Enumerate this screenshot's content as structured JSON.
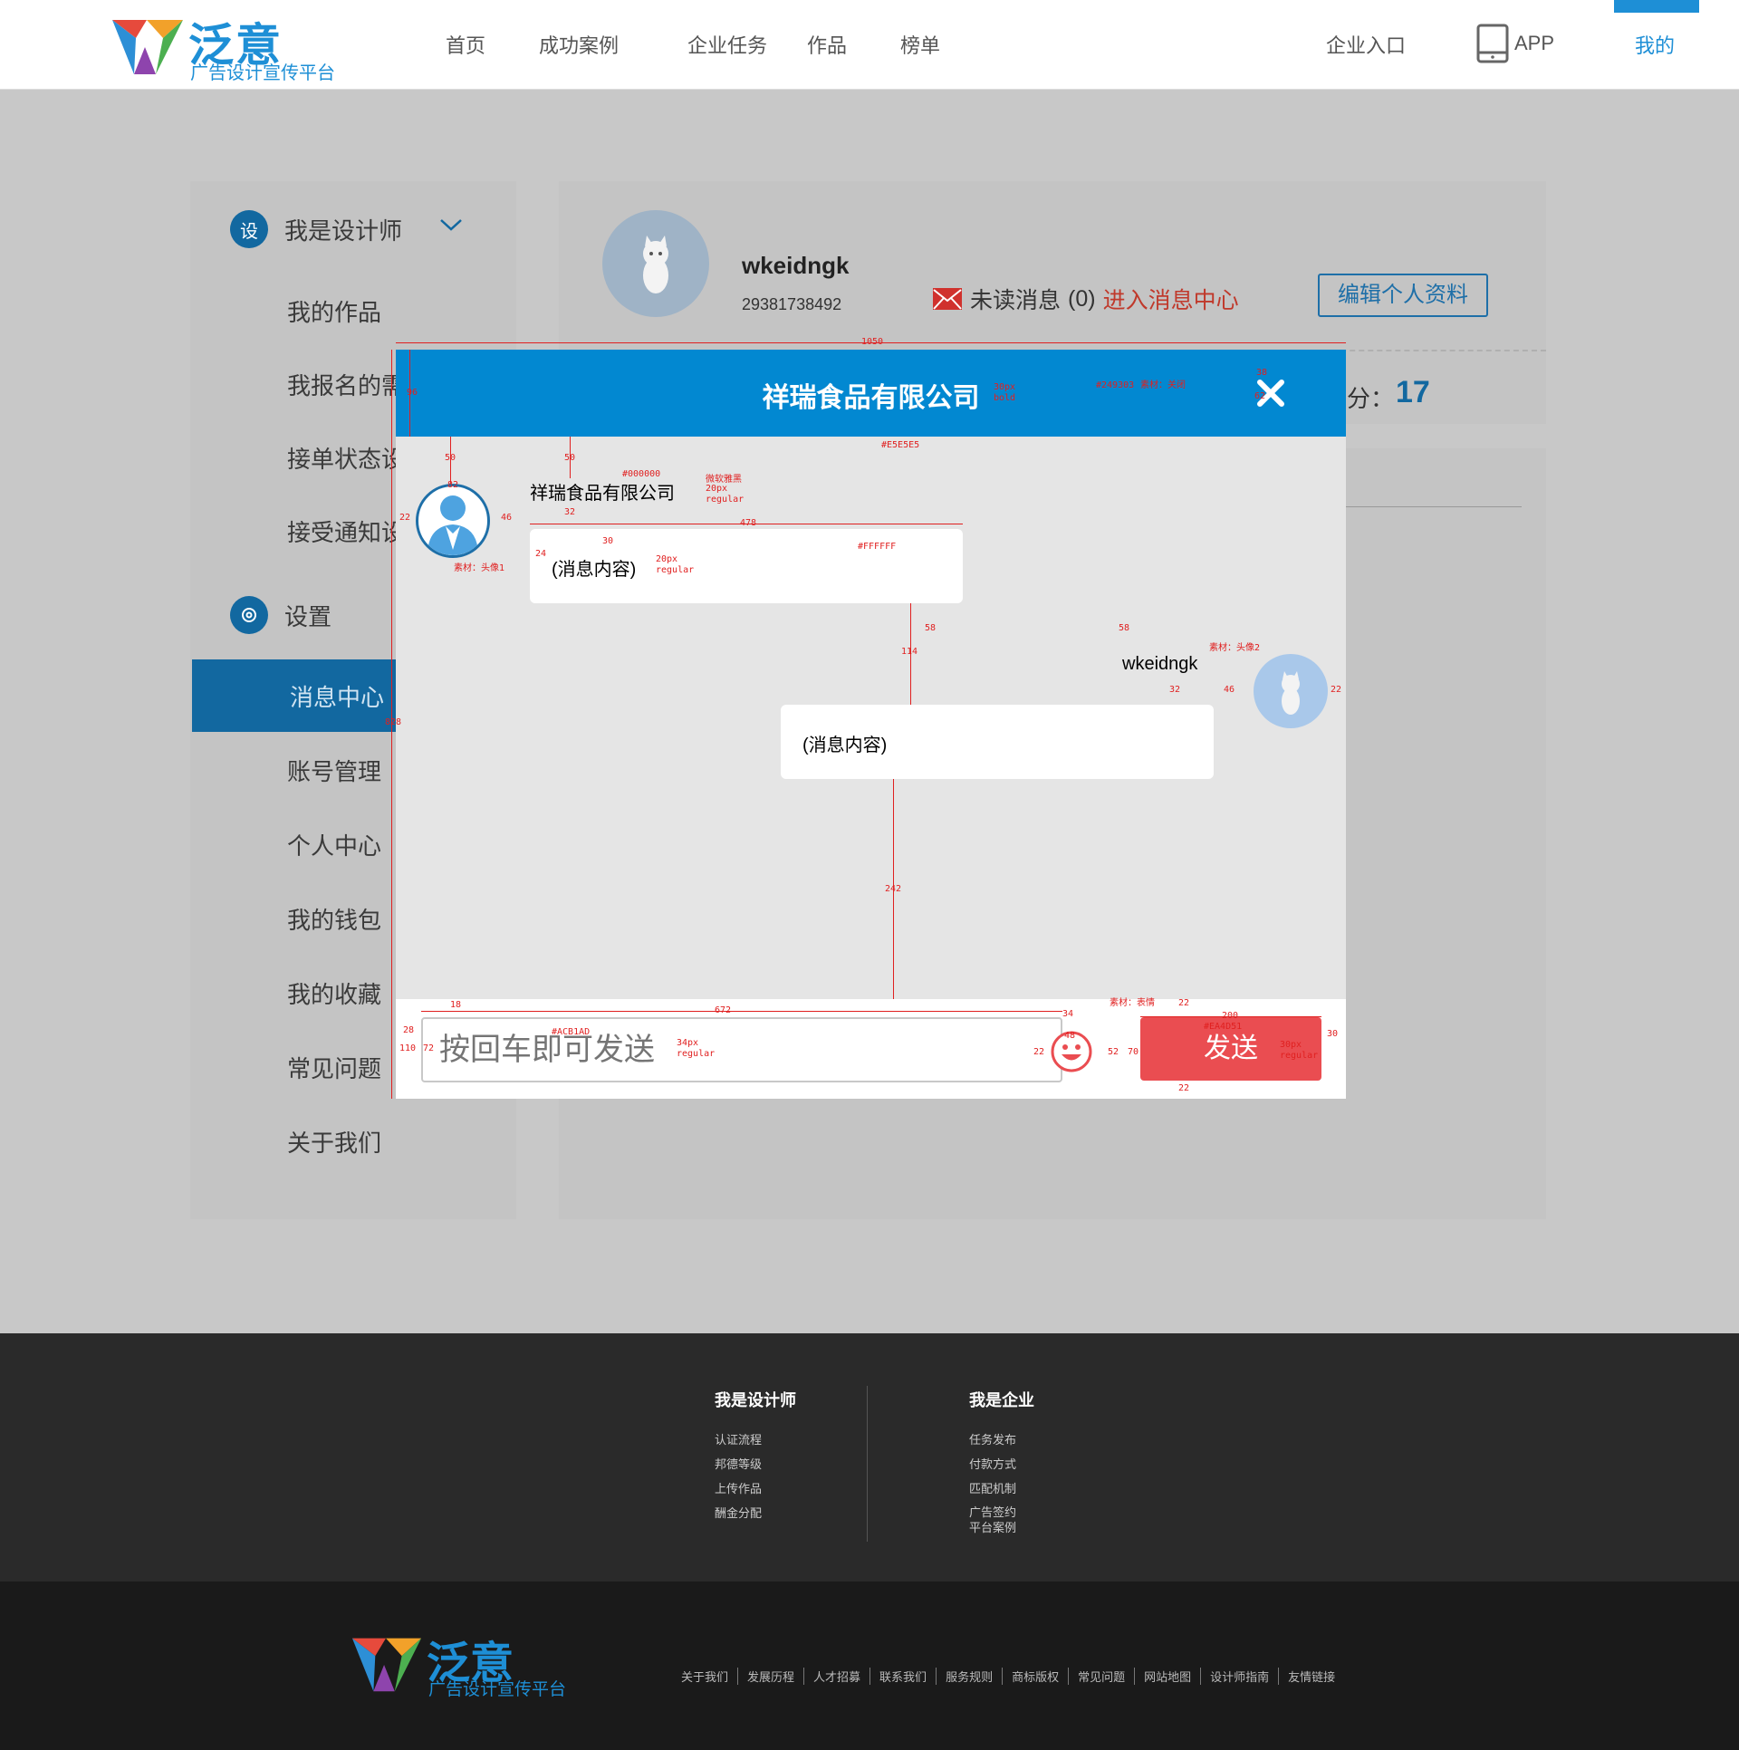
{
  "header": {
    "brand": "泛意",
    "slogan": "广告设计宣传平台",
    "nav": [
      "首页",
      "成功案例",
      "企业任务",
      "作品",
      "榜单"
    ],
    "enterprise_entry": "企业入口",
    "app_label": "APP",
    "mine_label": "我的"
  },
  "sidebar": {
    "designer_group": {
      "icon_text": "设",
      "label": "我是设计师"
    },
    "designer_items": [
      "我的作品",
      "我报名的需",
      "接单状态设",
      "接受通知设"
    ],
    "settings_group": {
      "label": "设置"
    },
    "active_item": "消息中心",
    "settings_items": [
      "账号管理",
      "个人中心",
      "我的钱包",
      "我的收藏",
      "常见问题",
      "关于我们"
    ]
  },
  "profile": {
    "username": "wkeidngk",
    "user_id": "29381738492",
    "unread_label": "未读消息",
    "unread_count": "(0)",
    "message_center_link": "进入消息中心",
    "edit_button": "编辑个人资料",
    "score_label": "分：",
    "score_value": "17"
  },
  "dialog": {
    "title": "祥瑞食品有限公司",
    "left_sender": "祥瑞食品有限公司",
    "left_message": "(消息内容)",
    "right_sender": "wkeidngk",
    "right_message": "(消息内容)",
    "input_placeholder": "按回车即可发送",
    "send_button": "发送",
    "colors": {
      "header": "#0288d1",
      "background": "#e5e5e5",
      "bubble": "#ffffff",
      "placeholder": "#acb1ad",
      "send": "#ea4d51"
    },
    "annotations": {
      "width": "1050",
      "header_height": "96",
      "height": "828",
      "title_font": "30px",
      "title_weight": "bold",
      "header_color": "#249303",
      "bg_color": "#E5E5E5",
      "name_color": "#000000",
      "font_name": "微软雅黑",
      "font_size": "20px",
      "font_weight": "regular",
      "bubble_color": "#FFFFFF",
      "bubble_width": "478",
      "avatar_size": "82",
      "avatar1_tag": "素材：头像1",
      "avatar2_tag": "素材：头像2",
      "close_tag": "素材：关闭",
      "emoji_tag": "素材：表情",
      "input_width": "672",
      "input_color": "#ACB1AD",
      "input_font": "34px",
      "send_width": "200",
      "send_color": "#EA4D51",
      "send_font": "30px",
      "gap_50": "50",
      "gap_32": "32",
      "gap_114": "114",
      "gap_58": "58",
      "gap_242": "242",
      "gap_46": "46",
      "gap_22": "22",
      "gap_18": "18",
      "gap_110": "110",
      "gap_72": "72",
      "gap_70": "70",
      "gap_30": "30",
      "gap_24": "24",
      "gap_34": "34",
      "gap_48": "48",
      "gap_52": "52",
      "gap_38": "38",
      "gap_62": "62",
      "gap_28": "28"
    }
  },
  "footer": {
    "designer_title": "我是设计师",
    "designer_links": [
      "认证流程",
      "邦德等级",
      "上传作品",
      "酬金分配"
    ],
    "enterprise_title": "我是企业",
    "enterprise_links": [
      "任务发布",
      "付款方式",
      "匹配机制",
      "广告签约",
      "平台案例"
    ],
    "brand": "泛意",
    "slogan": "广告设计宣传平台",
    "bottom_links": [
      "关于我们",
      "发展历程",
      "人才招募",
      "联系我们",
      "服务规则",
      "商标版权",
      "常见问题",
      "网站地图",
      "设计师指南",
      "友情链接"
    ]
  }
}
